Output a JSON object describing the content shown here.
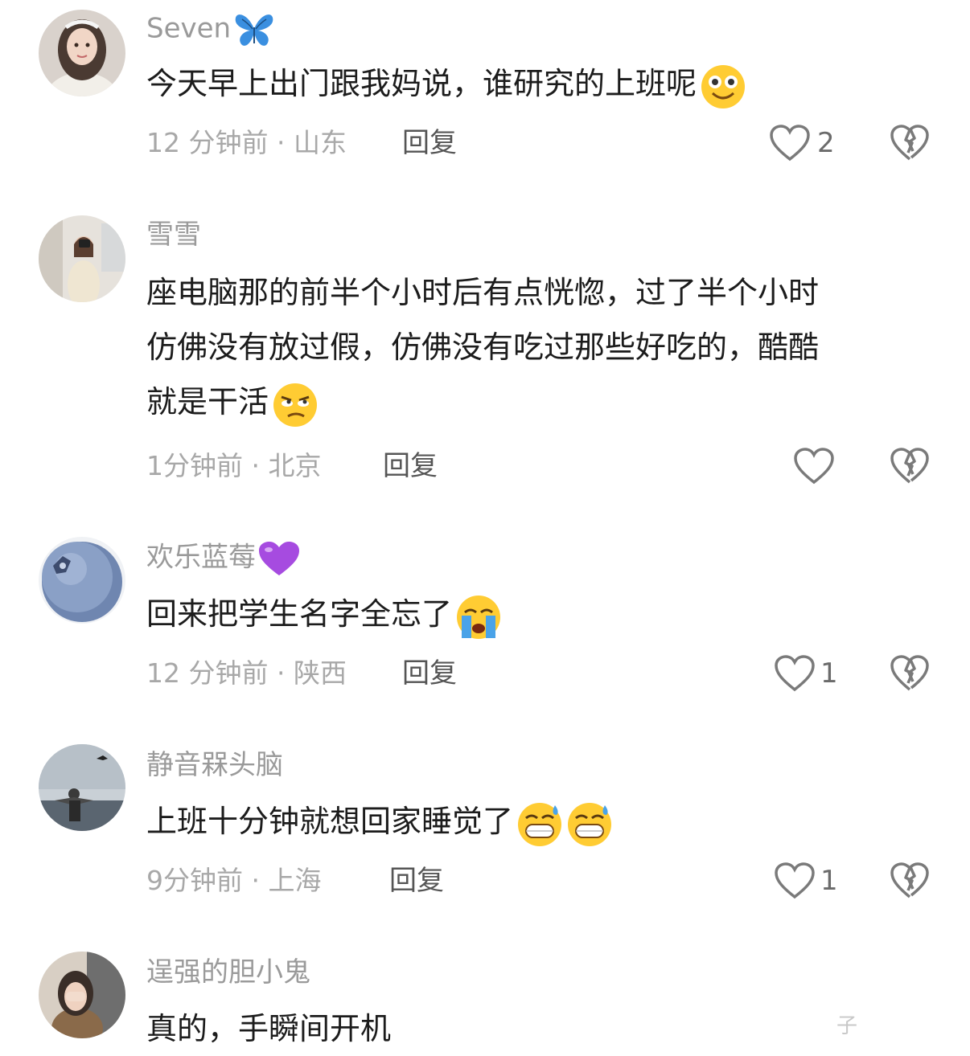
{
  "comments": [
    {
      "username": "Seven",
      "username_icon": "butterfly-icon",
      "text": "今天早上出门跟我妈说，谁研究的上班呢",
      "text_emojis": [
        "smiling-face-emoji"
      ],
      "time_location": "12 分钟前 · 山东",
      "reply_label": "回复",
      "like_count": "2"
    },
    {
      "username": "雪雪",
      "text_lines": [
        "座电脑那的前半个小时后有点恍惚，过了半个小时",
        "仿佛没有放过假，仿佛没有吃过那些好吃的，酷酷",
        "就是干活"
      ],
      "text_emojis": [
        "eye-roll-emoji"
      ],
      "time_location": "1分钟前 · 北京",
      "reply_label": "回复",
      "like_count": ""
    },
    {
      "username": "欢乐蓝莓",
      "username_icon": "purple-heart-icon",
      "text": "回来把学生名字全忘了",
      "text_emojis": [
        "crying-face-emoji"
      ],
      "time_location": "12 分钟前 · 陕西",
      "reply_label": "回复",
      "like_count": "1"
    },
    {
      "username": "静音槑头脑",
      "text": "上班十分钟就想回家睡觉了",
      "text_emojis": [
        "grinning-sweat-emoji",
        "grinning-sweat-emoji"
      ],
      "time_location": "9分钟前 · 上海",
      "reply_label": "回复",
      "like_count": "1"
    },
    {
      "username": "逞强的胆小鬼",
      "text": "真的，手瞬间开机"
    }
  ],
  "watermark": "子",
  "colors": {
    "username": "#9a9a9a",
    "text": "#1c1c1c",
    "meta": "#a8a8a8",
    "icon": "#7a7a7a"
  }
}
